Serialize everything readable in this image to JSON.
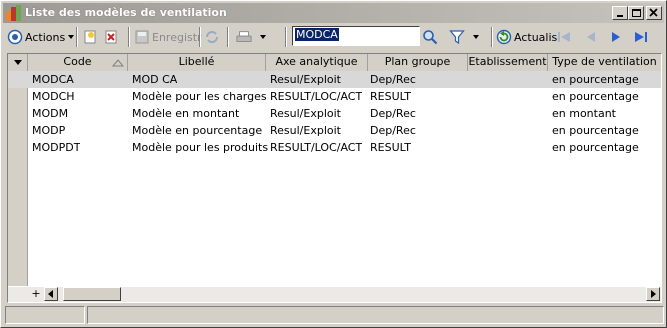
{
  "window": {
    "title": "Liste des modèles de ventilation"
  },
  "toolbar": {
    "actions_label": "Actions",
    "save_label": "Enregistr",
    "search_value": "MODCA",
    "refresh_label": "Actualisi"
  },
  "grid": {
    "columns": [
      "Code",
      "Libellé",
      "Axe analytique",
      "Plan groupe",
      "Etablissement",
      "Type de ventilation"
    ],
    "sort_column": "Code",
    "selected_row": 0,
    "rows": [
      [
        "MODCA",
        "MOD CA",
        "Resul/Exploit",
        "Dep/Rec",
        "",
        "en pourcentage"
      ],
      [
        "MODCH",
        "Modèle pour les charges",
        "RESULT/LOC/ACT",
        "RESULT",
        "",
        "en pourcentage"
      ],
      [
        "MODM",
        "Modèle en montant",
        "Resul/Exploit",
        "Dep/Rec",
        "",
        "en montant"
      ],
      [
        "MODP",
        "Modèle en pourcentage",
        "Resul/Exploit",
        "Dep/Rec",
        "",
        "en pourcentage"
      ],
      [
        "MODPDT",
        "Modèle pour les produits",
        "RESULT/LOC/ACT",
        "RESULT",
        "",
        "en pourcentage"
      ]
    ]
  },
  "footer": {
    "add_row_symbol": "+"
  }
}
